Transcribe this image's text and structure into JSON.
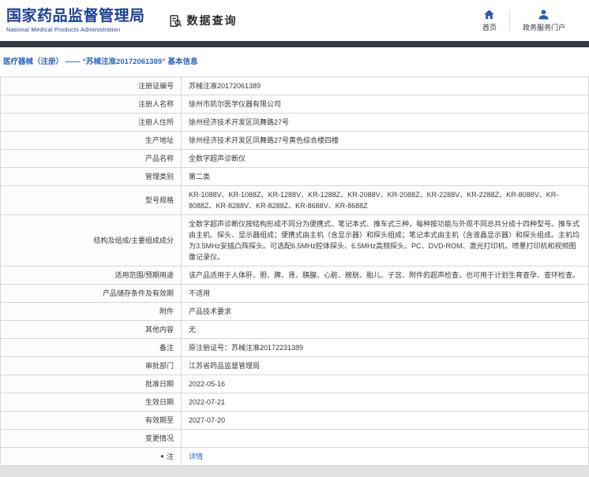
{
  "colors": {
    "brand_blue": "#1d3f96",
    "icon_blue": "#2a5caa",
    "link_blue": "#2a65c0",
    "strip_dark": "#353a47"
  },
  "header": {
    "agency_name_cn": "国家药品监督管理局",
    "agency_name_en": "National Medical Products Administration",
    "module_title": "数据查询",
    "nav": [
      {
        "icon": "home-icon",
        "label": "首页"
      },
      {
        "icon": "portal-user-icon",
        "label": "政务服务门户"
      }
    ]
  },
  "breadcrumb": {
    "text": "医疗器械（注册） —— “苏械注准20172061389” 基本信息"
  },
  "icons": {
    "note_glyph": "●"
  },
  "table": {
    "rows": [
      {
        "label": "注册证编号",
        "value": "苏械注准20172061389"
      },
      {
        "label": "注册人名称",
        "value": "徐州市凯尔医学仪器有限公司"
      },
      {
        "label": "注册人住所",
        "value": "徐州经济技术开发区凤舞路27号"
      },
      {
        "label": "生产地址",
        "value": "徐州经济技术开发区凤舞路27号黄色综合楼四楼"
      },
      {
        "label": "产品名称",
        "value": "全数字超声诊断仪"
      },
      {
        "label": "管理类别",
        "value": "第二类"
      },
      {
        "label": "型号规格",
        "value": "KR-1088V、KR-1088Z、KR-1288V、KR-1288Z、KR-2088V、KR-2088Z、KR-2288V、KR-2288Z、KR-8088V、KR-8088Z、KR-8288V、KR-8288Z、KR-8688V、KR-8688Z"
      },
      {
        "label": "结构及组成/主要组成成分",
        "value": "全数字超声诊断仪按结构形成不同分为便携式、笔记本式、推车式三种，每种按功能与外观不同总共分成十四种型号。推车式由主机、探头、显示器组成；便携式由主机（含显示器）和探头组成；笔记本式由主机（含液晶显示器）和探头组成。主机均为3.5MHz安插凸阵探头。可选配6.5MHz腔体探头、6.5MHz高频探头、PC、DVD-ROM、激光打印机、喷墨打印机和视频图像记录仪。"
      },
      {
        "label": "适用范围/预期用途",
        "value": "该产品适用于人体肝、胆、脾、肾、胰腺、心脏、膀胱、胎儿、子宫、附件的超声检查，也可用于计划生育查孕、查环检查。"
      },
      {
        "label": "产品储存条件及有效期",
        "value": "不适用"
      },
      {
        "label": "附件",
        "value": "产品技术要求"
      },
      {
        "label": "其他内容",
        "value": "无"
      },
      {
        "label": "备注",
        "value": "原注册证号：苏械注准20172231389"
      },
      {
        "label": "审批部门",
        "value": "江苏省药品监督管理局"
      },
      {
        "label": "批准日期",
        "value": "2022-05-16"
      },
      {
        "label": "生效日期",
        "value": "2022-07-21"
      },
      {
        "label": "有效期至",
        "value": "2027-07-20"
      },
      {
        "label": "变更情况",
        "value": ""
      },
      {
        "label": "注",
        "value": "详情"
      }
    ]
  }
}
